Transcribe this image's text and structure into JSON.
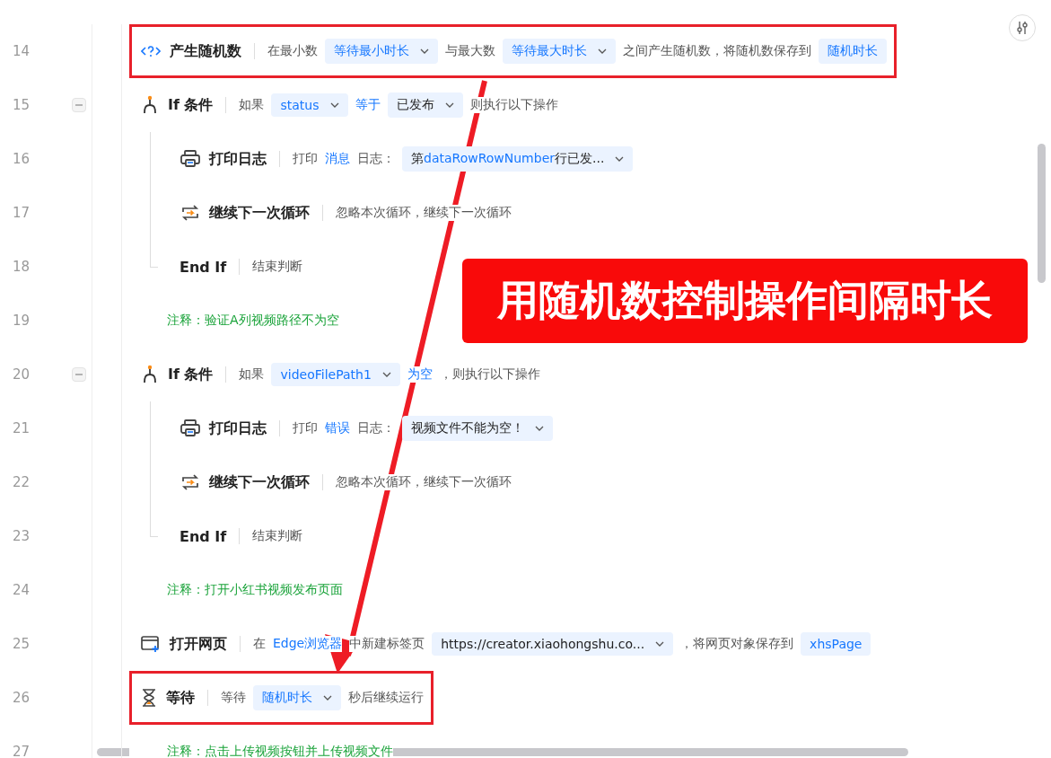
{
  "steps": [
    {
      "line": "14",
      "kind": "random",
      "title": "产生随机数",
      "highlighted": true,
      "parts": [
        {
          "kind": "text",
          "text": "在最小数"
        },
        {
          "kind": "select",
          "segments": [
            {
              "kind": "var",
              "text": "等待最小时长"
            }
          ]
        },
        {
          "kind": "text",
          "text": "与最大数"
        },
        {
          "kind": "select",
          "segments": [
            {
              "kind": "var",
              "text": "等待最大时长"
            }
          ]
        },
        {
          "kind": "text",
          "text": "之间产生随机数，将随机数保存到"
        },
        {
          "kind": "chip",
          "text": "随机时长"
        }
      ]
    },
    {
      "line": "15",
      "kind": "if",
      "title": "If 条件",
      "expanded": true,
      "parts": [
        {
          "kind": "text",
          "text": "如果"
        },
        {
          "kind": "select",
          "segments": [
            {
              "kind": "var",
              "text": "status"
            }
          ]
        },
        {
          "kind": "link",
          "text": "等于"
        },
        {
          "kind": "select",
          "segments": [
            {
              "kind": "lit",
              "text": "已发布"
            }
          ]
        },
        {
          "kind": "text",
          "text": "则执行以下操作"
        }
      ],
      "children": [
        {
          "line": "16",
          "kind": "print",
          "title": "打印日志",
          "parts": [
            {
              "kind": "text",
              "text": "打印"
            },
            {
              "kind": "link",
              "text": "消息"
            },
            {
              "kind": "text",
              "text": "日志："
            },
            {
              "kind": "select",
              "segments": [
                {
                  "kind": "lit",
                  "text": "第"
                },
                {
                  "kind": "var",
                  "text": "dataRow"
                },
                {
                  "kind": "var",
                  "text": "RowNumber"
                },
                {
                  "kind": "lit",
                  "text": "行已发..."
                }
              ]
            }
          ]
        },
        {
          "line": "17",
          "kind": "continue",
          "title": "继续下一次循环",
          "parts": [
            {
              "kind": "text",
              "text": "忽略本次循环，继续下一次循环"
            }
          ]
        }
      ],
      "end": {
        "line": "18",
        "title": "End If",
        "parts": [
          {
            "kind": "text",
            "text": "结束判断"
          }
        ]
      }
    },
    {
      "line": "19",
      "kind": "comment",
      "title": "注释：验证A列视频路径不为空"
    },
    {
      "line": "20",
      "kind": "if",
      "title": "If 条件",
      "expanded": true,
      "parts": [
        {
          "kind": "text",
          "text": "如果"
        },
        {
          "kind": "select",
          "segments": [
            {
              "kind": "var",
              "text": "videoFilePath1"
            }
          ]
        },
        {
          "kind": "link",
          "text": "为空"
        },
        {
          "kind": "text",
          "text": "，则执行以下操作"
        }
      ],
      "children": [
        {
          "line": "21",
          "kind": "print",
          "title": "打印日志",
          "parts": [
            {
              "kind": "text",
              "text": "打印"
            },
            {
              "kind": "link",
              "text": "错误"
            },
            {
              "kind": "text",
              "text": "日志："
            },
            {
              "kind": "select",
              "segments": [
                {
                  "kind": "lit",
                  "text": "视频文件不能为空！"
                }
              ]
            }
          ]
        },
        {
          "line": "22",
          "kind": "continue",
          "title": "继续下一次循环",
          "parts": [
            {
              "kind": "text",
              "text": "忽略本次循环，继续下一次循环"
            }
          ]
        }
      ],
      "end": {
        "line": "23",
        "title": "End If",
        "parts": [
          {
            "kind": "text",
            "text": "结束判断"
          }
        ]
      }
    },
    {
      "line": "24",
      "kind": "comment",
      "title": "注释：打开小红书视频发布页面"
    },
    {
      "line": "25",
      "kind": "open_page",
      "title": "打开网页",
      "parts": [
        {
          "kind": "text",
          "text": "在"
        },
        {
          "kind": "link",
          "text": "Edge浏览器"
        },
        {
          "kind": "text",
          "text": "中新建标签页"
        },
        {
          "kind": "select",
          "segments": [
            {
              "kind": "lit",
              "text": "https://creator.xiaohongshu.co..."
            }
          ]
        },
        {
          "kind": "text",
          "text": "，将网页对象保存到"
        },
        {
          "kind": "chip",
          "text": "xhsPage"
        }
      ]
    },
    {
      "line": "26",
      "kind": "wait",
      "title": "等待",
      "highlighted": true,
      "parts": [
        {
          "kind": "text",
          "text": "等待"
        },
        {
          "kind": "select",
          "segments": [
            {
              "kind": "var",
              "text": "随机时长"
            }
          ]
        },
        {
          "kind": "text",
          "text": "秒后继续运行"
        }
      ]
    },
    {
      "line": "27",
      "kind": "comment",
      "title": "注释：点击上传视频按钮并上传视频文件"
    }
  ],
  "banner": "用随机数控制操作间隔时长"
}
